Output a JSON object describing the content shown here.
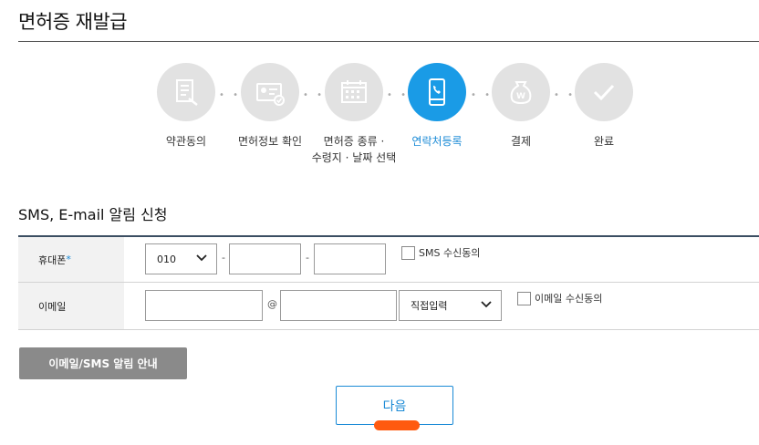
{
  "page": {
    "title": "면허증 재발급"
  },
  "steps": [
    {
      "label": "약관동의",
      "icon": "document-check-icon",
      "active": false
    },
    {
      "label": "면허정보 확인",
      "icon": "id-card-check-icon",
      "active": false
    },
    {
      "label": "면허증 종류 · 수령지 · 날짜 선택",
      "line1": "면허증 종류 ·",
      "line2": "수령지 · 날짜 선택",
      "icon": "calendar-icon",
      "active": false
    },
    {
      "label": "연락처등록",
      "icon": "mobile-phone-icon",
      "active": true
    },
    {
      "label": "결제",
      "icon": "won-pouch-icon",
      "active": false
    },
    {
      "label": "완료",
      "icon": "checkmark-icon",
      "active": false
    }
  ],
  "section": {
    "title": "SMS, E-mail 알림 신청"
  },
  "form": {
    "phone": {
      "label": "휴대폰",
      "required_mark": "*",
      "prefix_value": "010",
      "separator": "-",
      "sms_consent_label": "SMS 수신동의"
    },
    "email": {
      "label": "이메일",
      "at_sign": "@",
      "domain_select_value": "직접입력",
      "email_consent_label": "이메일 수신동의"
    }
  },
  "buttons": {
    "info_label": "이메일/SMS 알림 안내",
    "next_label": "다음"
  },
  "colors": {
    "accent": "#1a9be6",
    "inactive_step": "#e2e2e2",
    "highlight": "#ff5a10",
    "info_button": "#8a8a8a"
  }
}
